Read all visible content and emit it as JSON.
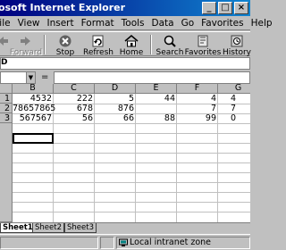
{
  "window": {
    "title": "crosoft Internet Explorer"
  },
  "menu": [
    "File",
    "View",
    "Insert",
    "Format",
    "Tools",
    "Data",
    "Go",
    "Favorites",
    "Help"
  ],
  "toolbar": {
    "forward": "Forward",
    "stop": "Stop",
    "refresh": "Refresh",
    "home": "Home",
    "search": "Search",
    "favorites": "Favorites",
    "history": "History"
  },
  "address": {
    "value": ""
  },
  "formula": {
    "name_box": "",
    "equals": "=",
    "value": ""
  },
  "sheet": {
    "columns": [
      "B",
      "C",
      "D",
      "E",
      "F",
      "G"
    ],
    "rows": [
      {
        "num": "1",
        "cells": [
          "4532",
          "222",
          "5",
          "44",
          "4",
          "4"
        ]
      },
      {
        "num": "2",
        "cells": [
          "78657865",
          "678",
          "876",
          "",
          "7",
          "7"
        ]
      },
      {
        "num": "3",
        "cells": [
          "567567",
          "56",
          "66",
          "88",
          "99",
          "0"
        ]
      }
    ]
  },
  "tabs": [
    "Sheet1",
    "Sheet2",
    "Sheet3"
  ],
  "status": {
    "zone": "Local intranet zone"
  },
  "colors": {
    "title_bar": "#000080",
    "chrome": "#c0c0c0",
    "grid": "#c0c0c0"
  }
}
